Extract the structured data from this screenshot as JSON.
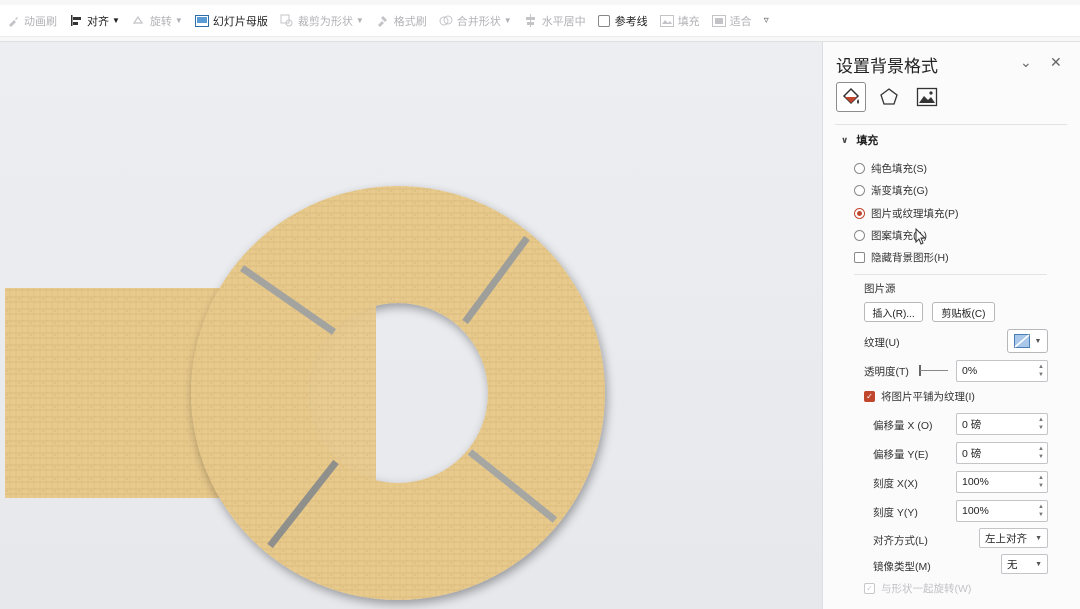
{
  "toolbar": {
    "items": [
      {
        "label": "动画刷",
        "icon": "brush-icon",
        "enabled": false,
        "dropdown": false
      },
      {
        "label": "对齐",
        "icon": "align-icon",
        "enabled": true,
        "dropdown": true
      },
      {
        "label": "旋转",
        "icon": "rotate-icon",
        "enabled": false,
        "dropdown": true
      },
      {
        "label": "幻灯片母版",
        "icon": "slide-master-icon",
        "enabled": true,
        "dropdown": false
      },
      {
        "label": "裁剪为形状",
        "icon": "crop-icon",
        "enabled": false,
        "dropdown": true
      },
      {
        "label": "格式刷",
        "icon": "format-painter-icon",
        "enabled": false,
        "dropdown": false
      },
      {
        "label": "合并形状",
        "icon": "merge-shapes-icon",
        "enabled": false,
        "dropdown": true
      },
      {
        "label": "水平居中",
        "icon": "center-icon",
        "enabled": false,
        "dropdown": false
      },
      {
        "label": "参考线",
        "icon": "checkbox",
        "enabled": true,
        "dropdown": false
      },
      {
        "label": "填充",
        "icon": "fill-icon",
        "enabled": false,
        "dropdown": false
      },
      {
        "label": "适合",
        "icon": "fit-icon",
        "enabled": false,
        "dropdown": false
      }
    ],
    "more_icon": "more-chevron-icon"
  },
  "panel": {
    "title": "设置背景格式",
    "collapse_icon": "chevron-down-icon",
    "close_icon": "close-icon",
    "tabs": [
      {
        "icon": "fill-bucket-icon",
        "active": true
      },
      {
        "icon": "pentagon-effects-icon",
        "active": false
      },
      {
        "icon": "picture-icon",
        "active": false
      }
    ],
    "section_label": "填充",
    "fill_options": [
      {
        "label": "纯色填充(S)",
        "checked": false
      },
      {
        "label": "渐变填充(G)",
        "checked": false
      },
      {
        "label": "图片或纹理填充(P)",
        "checked": true
      },
      {
        "label": "图案填充(A)",
        "checked": false
      }
    ],
    "hide_bg_label": "隐藏背景图形(H)",
    "picture_source_label": "图片源",
    "insert_button": "插入(R)...",
    "clipboard_button": "剪贴板(C)",
    "texture_label": "纹理(U)",
    "transparency_label": "透明度(T)",
    "transparency_value": "0%",
    "tile_label": "将图片平铺为纹理(I)",
    "tile_checked": true,
    "offset_x_label": "偏移量 X (O)",
    "offset_x_value": "0 磅",
    "offset_y_label": "偏移量 Y(E)",
    "offset_y_value": "0 磅",
    "scale_x_label": "刻度 X(X)",
    "scale_x_value": "100%",
    "scale_y_label": "刻度 Y(Y)",
    "scale_y_value": "100%",
    "align_label": "对齐方式(L)",
    "align_value": "左上对齐",
    "mirror_label": "镜像类型(M)",
    "mirror_value": "无",
    "rotate_with_shape_label": "与形状一起旋转(W)"
  },
  "colors": {
    "accent": "#c0462d",
    "wood": "#e7c98b",
    "canvas_bg": "#e8eaee"
  }
}
